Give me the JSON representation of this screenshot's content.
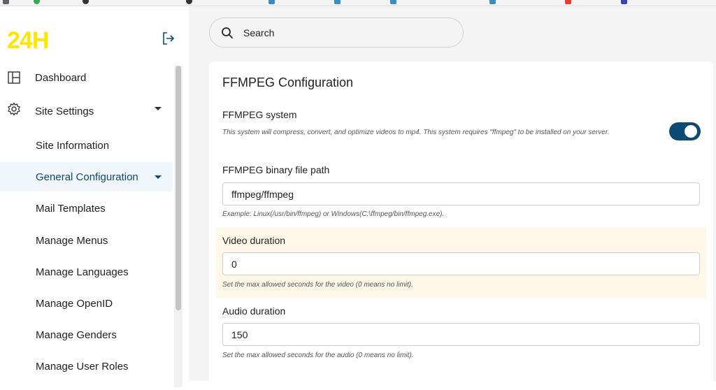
{
  "app": {
    "logo_text": "24H",
    "brand_color": "#ffe600",
    "accent_color": "#0d4a73"
  },
  "sidebar": {
    "collapse_icon": "logout-arrow-icon",
    "items": [
      {
        "label": "Dashboard",
        "icon": "dashboard-layout-icon"
      },
      {
        "label": "Site Settings",
        "icon": "gear-icon"
      },
      {
        "label": "Site Information"
      },
      {
        "label": "General Configuration",
        "active": true
      },
      {
        "label": "Mail Templates"
      },
      {
        "label": "Manage Menus"
      },
      {
        "label": "Manage Languages"
      },
      {
        "label": "Manage OpenID"
      },
      {
        "label": "Manage Genders"
      },
      {
        "label": "Manage User Roles"
      }
    ]
  },
  "header": {
    "search_placeholder": "Search",
    "search_icon": "search-icon"
  },
  "card": {
    "title": "FFMPEG Configuration",
    "ffmpeg_system": {
      "label": "FFMPEG system",
      "help": "This system will compress, convert, and optimize videos to mp4. This system requires \"ffmpeg\" to be installed on your server.",
      "enabled": true
    },
    "binary_path": {
      "label": "FFMPEG binary file path",
      "value": "ffmpeg/ffmpeg",
      "help": "Example: Linux(/usr/bin/ffmpeg) or Windows(C:\\ffmpeg/bin/ffmpeg.exe)."
    },
    "video_duration": {
      "label": "Video duration",
      "value": "0",
      "help": "Set the max allowed seconds for the video (0 means no limit)."
    },
    "audio_duration": {
      "label": "Audio duration",
      "value": "150",
      "help": "Set the max allowed seconds for the audio (0 means no limit)."
    }
  }
}
